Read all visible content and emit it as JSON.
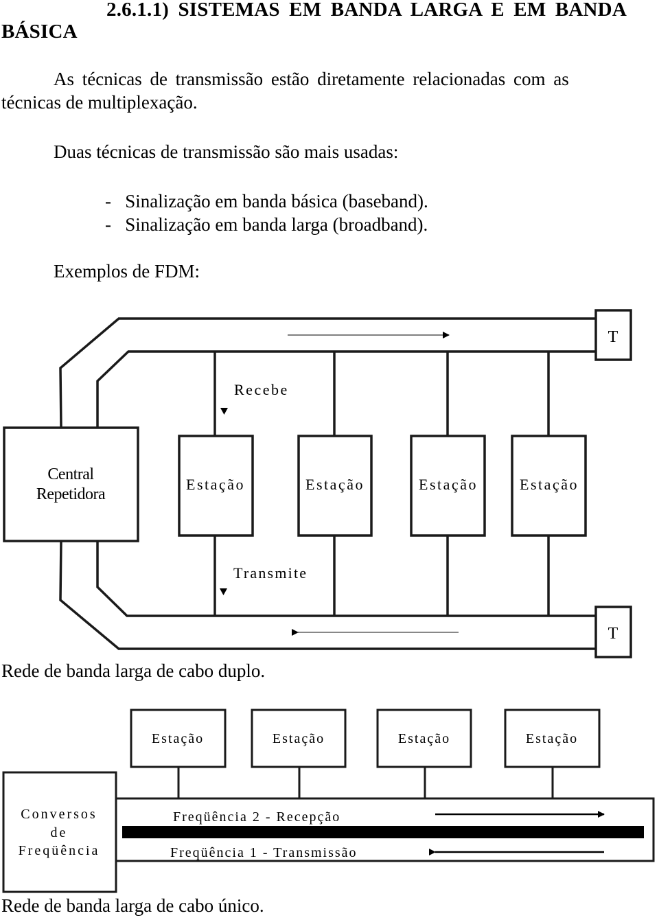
{
  "heading": {
    "line1": "2.6.1.1) SISTEMAS EM BANDA LARGA E EM BANDA",
    "line2": "BÁSICA"
  },
  "paragraphs": {
    "p1_line1": "As técnicas de transmissão estão diretamente relacionadas com as",
    "p1_line2": "técnicas de multiplexação.",
    "p2": "Duas técnicas de transmissão são mais usadas:",
    "bullets": [
      "-   Sinalização em banda básica (baseband).",
      "-   Sinalização em banda larga (broadband)."
    ],
    "examples_label": "Exemplos de FDM:"
  },
  "diagram_dual": {
    "terminator_top": "T",
    "terminator_bottom": "T",
    "receive_label": "Recebe",
    "transmit_label": "Transmite",
    "central_line1": "Central",
    "central_line2": "Repetidora",
    "stations": [
      "Estação",
      "Estação",
      "Estação",
      "Estação"
    ],
    "caption": "Rede de banda larga de cabo duplo."
  },
  "diagram_single": {
    "stations": [
      "Estação",
      "Estação",
      "Estação",
      "Estação"
    ],
    "converter_line1": "Conversos",
    "converter_line2": "de",
    "converter_line3": "Freqüência",
    "freq2_label": "Freqüência 2 - Recepção",
    "freq1_label": "Freqüência 1 - Transmissão",
    "caption": "Rede de banda larga de cabo único."
  }
}
